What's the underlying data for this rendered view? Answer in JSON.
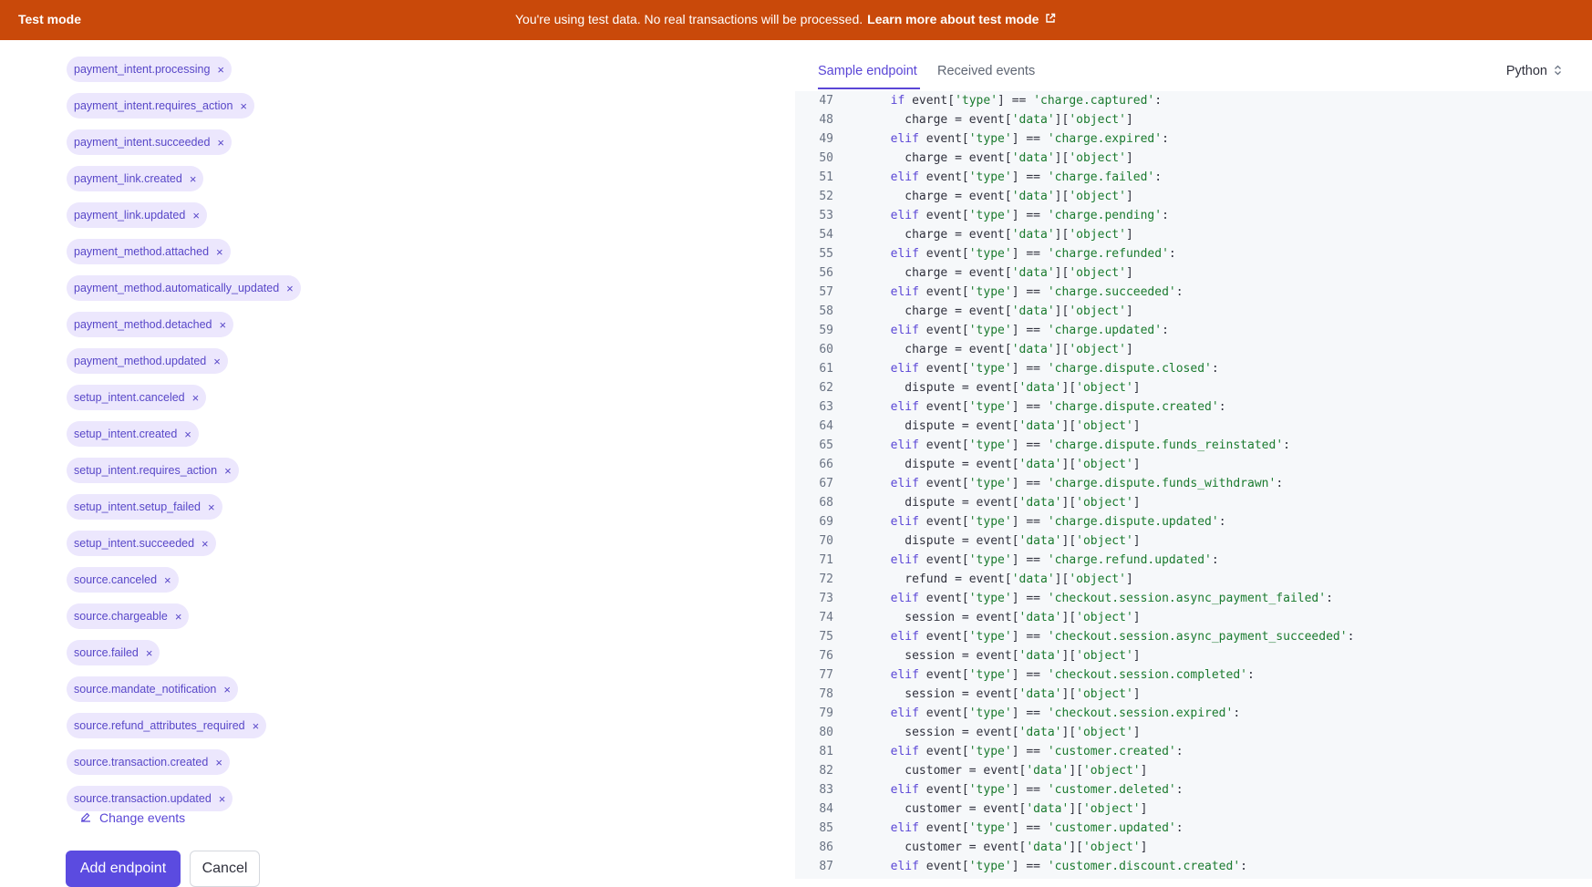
{
  "banner": {
    "mode_label": "Test mode",
    "message": "You're using test data. No real transactions will be processed.",
    "learn_more": "Learn more about test mode",
    "external_icon": "external-link-icon"
  },
  "events": [
    "payment_intent.processing",
    "payment_intent.requires_action",
    "payment_intent.succeeded",
    "payment_link.created",
    "payment_link.updated",
    "payment_method.attached",
    "payment_method.automatically_updated",
    "payment_method.detached",
    "payment_method.updated",
    "setup_intent.canceled",
    "setup_intent.created",
    "setup_intent.requires_action",
    "setup_intent.setup_failed",
    "setup_intent.succeeded",
    "source.canceled",
    "source.chargeable",
    "source.failed",
    "source.mandate_notification",
    "source.refund_attributes_required",
    "source.transaction.created",
    "source.transaction.updated"
  ],
  "remove_glyph": "×",
  "change_events_label": "Change events",
  "actions": {
    "add_label": "Add endpoint",
    "cancel_label": "Cancel"
  },
  "tabs": {
    "sample_endpoint": "Sample endpoint",
    "received_events": "Received events"
  },
  "language": "Python",
  "colors": {
    "banner": "#c9490a",
    "accent": "#5a46d6",
    "chip_bg": "#ece7fd",
    "string": "#1a7a2e"
  },
  "code_lines": [
    {
      "n": "47",
      "kw": "if",
      "type": "charge.captured"
    },
    {
      "n": "48",
      "var": "charge"
    },
    {
      "n": "49",
      "kw": "elif",
      "type": "charge.expired"
    },
    {
      "n": "50",
      "var": "charge"
    },
    {
      "n": "51",
      "kw": "elif",
      "type": "charge.failed"
    },
    {
      "n": "52",
      "var": "charge"
    },
    {
      "n": "53",
      "kw": "elif",
      "type": "charge.pending"
    },
    {
      "n": "54",
      "var": "charge"
    },
    {
      "n": "55",
      "kw": "elif",
      "type": "charge.refunded"
    },
    {
      "n": "56",
      "var": "charge"
    },
    {
      "n": "57",
      "kw": "elif",
      "type": "charge.succeeded"
    },
    {
      "n": "58",
      "var": "charge"
    },
    {
      "n": "59",
      "kw": "elif",
      "type": "charge.updated"
    },
    {
      "n": "60",
      "var": "charge"
    },
    {
      "n": "61",
      "kw": "elif",
      "type": "charge.dispute.closed"
    },
    {
      "n": "62",
      "var": "dispute"
    },
    {
      "n": "63",
      "kw": "elif",
      "type": "charge.dispute.created"
    },
    {
      "n": "64",
      "var": "dispute"
    },
    {
      "n": "65",
      "kw": "elif",
      "type": "charge.dispute.funds_reinstated"
    },
    {
      "n": "66",
      "var": "dispute"
    },
    {
      "n": "67",
      "kw": "elif",
      "type": "charge.dispute.funds_withdrawn"
    },
    {
      "n": "68",
      "var": "dispute"
    },
    {
      "n": "69",
      "kw": "elif",
      "type": "charge.dispute.updated"
    },
    {
      "n": "70",
      "var": "dispute"
    },
    {
      "n": "71",
      "kw": "elif",
      "type": "charge.refund.updated"
    },
    {
      "n": "72",
      "var": "refund"
    },
    {
      "n": "73",
      "kw": "elif",
      "type": "checkout.session.async_payment_failed"
    },
    {
      "n": "74",
      "var": "session"
    },
    {
      "n": "75",
      "kw": "elif",
      "type": "checkout.session.async_payment_succeeded"
    },
    {
      "n": "76",
      "var": "session"
    },
    {
      "n": "77",
      "kw": "elif",
      "type": "checkout.session.completed"
    },
    {
      "n": "78",
      "var": "session"
    },
    {
      "n": "79",
      "kw": "elif",
      "type": "checkout.session.expired"
    },
    {
      "n": "80",
      "var": "session"
    },
    {
      "n": "81",
      "kw": "elif",
      "type": "customer.created"
    },
    {
      "n": "82",
      "var": "customer"
    },
    {
      "n": "83",
      "kw": "elif",
      "type": "customer.deleted"
    },
    {
      "n": "84",
      "var": "customer"
    },
    {
      "n": "85",
      "kw": "elif",
      "type": "customer.updated"
    },
    {
      "n": "86",
      "var": "customer"
    },
    {
      "n": "87",
      "kw": "elif",
      "type": "customer.discount.created"
    }
  ]
}
